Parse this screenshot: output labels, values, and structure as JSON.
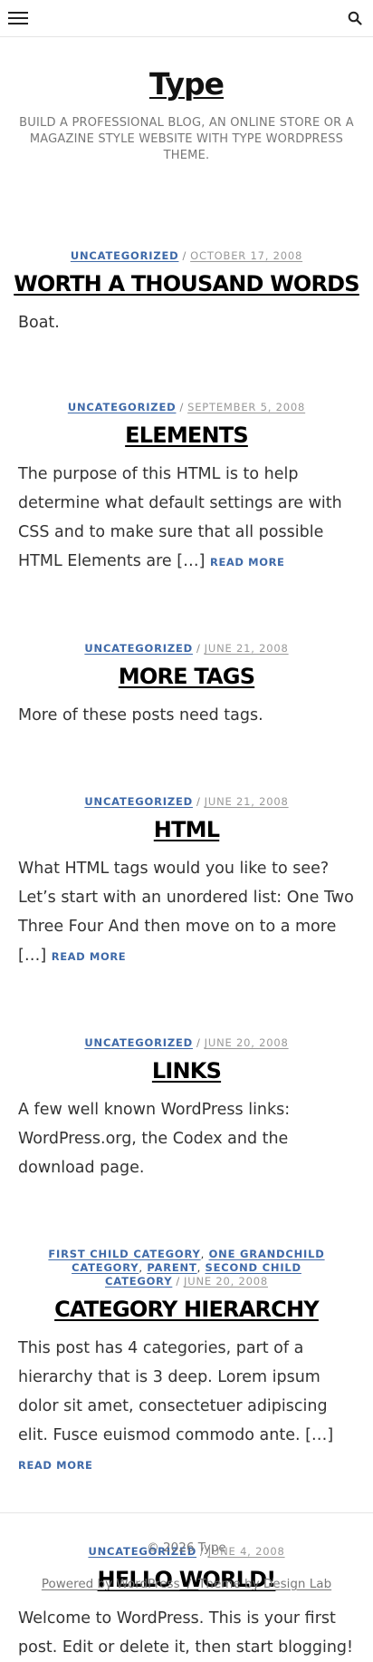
{
  "header": {
    "menu_icon": "hamburger-menu-icon",
    "search_icon": "search-icon"
  },
  "site": {
    "title": "Type",
    "tagline": "Build a professional blog, an online store or a magazine style website with Type WordPress theme."
  },
  "posts": [
    {
      "categories": [
        "Uncategorized"
      ],
      "date": "October 17, 2008",
      "title": "Worth a Thousand Words",
      "excerpt": "Boat.",
      "read_more": ""
    },
    {
      "categories": [
        "Uncategorized"
      ],
      "date": "September 5, 2008",
      "title": "Elements",
      "excerpt": "The purpose of this HTML is to help determine what default settings are with CSS and to make sure that all possible HTML Elements are […]",
      "read_more": "Read More"
    },
    {
      "categories": [
        "Uncategorized"
      ],
      "date": "June 21, 2008",
      "title": "More Tags",
      "excerpt": "More of these posts need tags.",
      "read_more": ""
    },
    {
      "categories": [
        "Uncategorized"
      ],
      "date": "June 21, 2008",
      "title": "HTML",
      "excerpt": "What HTML tags would you like to see? Let’s start with an unordered list: One Two Three Four And then move on to a more […]",
      "read_more": "Read More"
    },
    {
      "categories": [
        "Uncategorized"
      ],
      "date": "June 20, 2008",
      "title": "Links",
      "excerpt": "A few well known WordPress links: WordPress.org, the Codex and the download page.",
      "read_more": ""
    },
    {
      "categories": [
        "First Child Category",
        "One Grandchild Category",
        "Parent",
        "Second Child Category"
      ],
      "date": "June 20, 2008",
      "title": "Category Hierarchy",
      "excerpt": "This post has 4 categories, part of a hierarchy that is 3 deep. Lorem ipsum dolor sit amet, consectetuer adipiscing elit. Fusce euismod commodo ante. […]",
      "read_more": "Read More"
    },
    {
      "categories": [
        "Uncategorized"
      ],
      "date": "June 4, 2008",
      "title": "Hello world!",
      "excerpt": "Welcome to WordPress. This is your first post. Edit or delete it, then start blogging!",
      "read_more": ""
    }
  ],
  "footer": {
    "copyright": "© 2026 Type",
    "powered": "Powered by WordPress",
    "separator": "/",
    "theme": "Theme by Design Lab"
  },
  "colors": {
    "accent": "#3e69a8",
    "muted": "#999999"
  }
}
